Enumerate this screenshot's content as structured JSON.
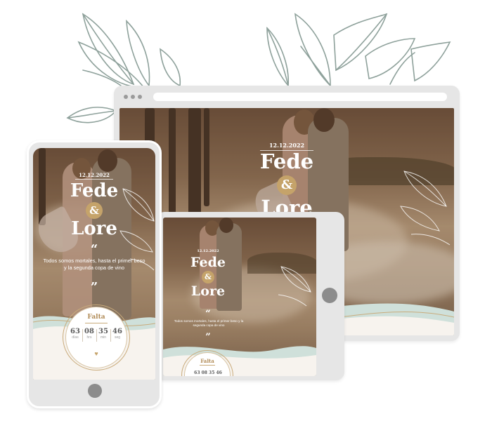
{
  "invitation": {
    "date": "12.12.2022",
    "name_1": "Fede",
    "ampersand": "&",
    "name_2": "Lore",
    "quote_mark_open": "“",
    "quote_mark_close": "”",
    "quote": "Todos somos mortales, hasta el primer beso y la segunda copa de vino",
    "countdown_label": "Falta",
    "countdown": [
      {
        "value": "63",
        "unit": "días"
      },
      {
        "value": "08",
        "unit": "hrs"
      },
      {
        "value": "35",
        "unit": "min"
      },
      {
        "value": "46",
        "unit": "seg"
      }
    ],
    "tablet_countdown_partial": "63 08 35 46"
  },
  "colors": {
    "accent_gold": "#c5a36a",
    "wave_mint": "#cfe0da",
    "cream": "#f7f3ee",
    "leaf_stroke": "#8ea19b",
    "device_frame": "#e6e6e6"
  },
  "icons": {
    "heart": "♥"
  }
}
